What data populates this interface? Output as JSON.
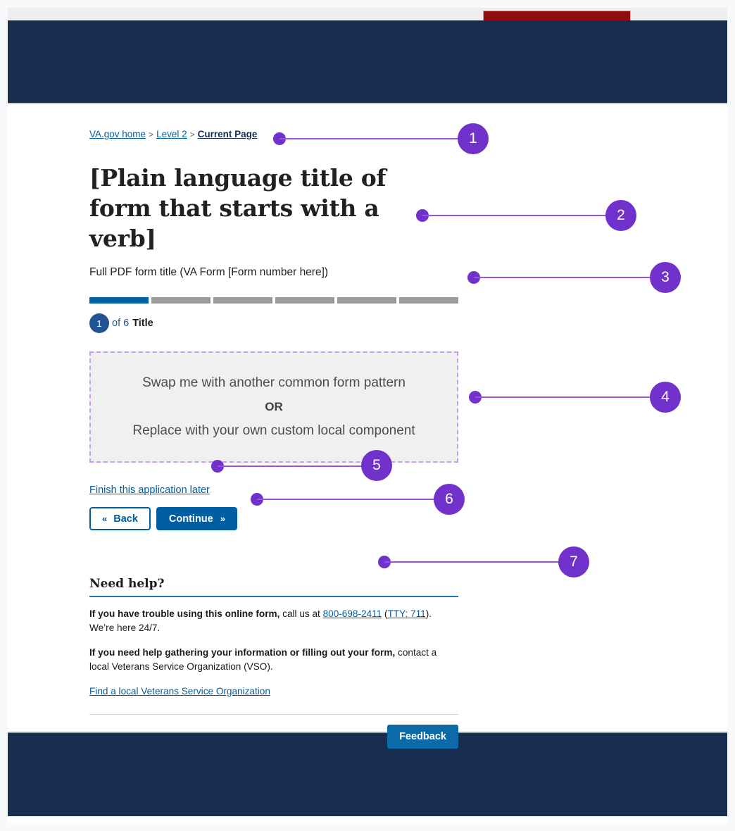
{
  "page": {
    "background_color": "#f8f9fa",
    "header_color": "#172e50",
    "footer_color": "#172e50",
    "accent_purple": "#7131cb",
    "accent_blue": "#005ea2",
    "red_block_color": "#8f0d0d"
  },
  "breadcrumb": {
    "items": [
      {
        "label": "VA.gov home",
        "current": false
      },
      {
        "label": "Level 2",
        "current": false
      },
      {
        "label": "Current Page",
        "current": true
      }
    ],
    "separator": ">"
  },
  "title": {
    "heading": "[Plain language title of form that starts with a verb]",
    "subtitle": "Full PDF form title (VA Form [Form number here])"
  },
  "progress": {
    "total_segments": 6,
    "filled_segments": 1,
    "current_step": "1",
    "of_label": "of 6",
    "step_title": "Title",
    "filled_color": "#0062a6",
    "empty_color": "#9b9b9b"
  },
  "pattern_placeholder": {
    "line1": "Swap me with another common form pattern",
    "or": "OR",
    "line2": "Replace with your own custom local component"
  },
  "actions": {
    "finish_later": "Finish this application later",
    "back_label": "Back",
    "back_chevron": "«",
    "continue_label": "Continue",
    "continue_chevron": "»"
  },
  "need_help": {
    "heading": "Need help?",
    "paragraph1_bold": "If you have trouble using this online form,",
    "paragraph1_text_a": " call us at ",
    "phone": "800-698-2411",
    "paragraph1_text_b": " (",
    "tty": "TTY: 711",
    "paragraph1_text_c": "). We’re here 24/7.",
    "paragraph2_bold": "If you need help gathering your information or filling out your form,",
    "paragraph2_text": " contact a local Veterans Service Organization (VSO).",
    "vso_link": "Find a local Veterans Service Organization"
  },
  "feedback": {
    "label": "Feedback"
  },
  "annotations": [
    {
      "number": "1",
      "target": "breadcrumb"
    },
    {
      "number": "2",
      "target": "form-title"
    },
    {
      "number": "3",
      "target": "progress-bar"
    },
    {
      "number": "4",
      "target": "pattern-placeholder"
    },
    {
      "number": "5",
      "target": "finish-later-link"
    },
    {
      "number": "6",
      "target": "nav-buttons"
    },
    {
      "number": "7",
      "target": "need-help-section"
    }
  ]
}
